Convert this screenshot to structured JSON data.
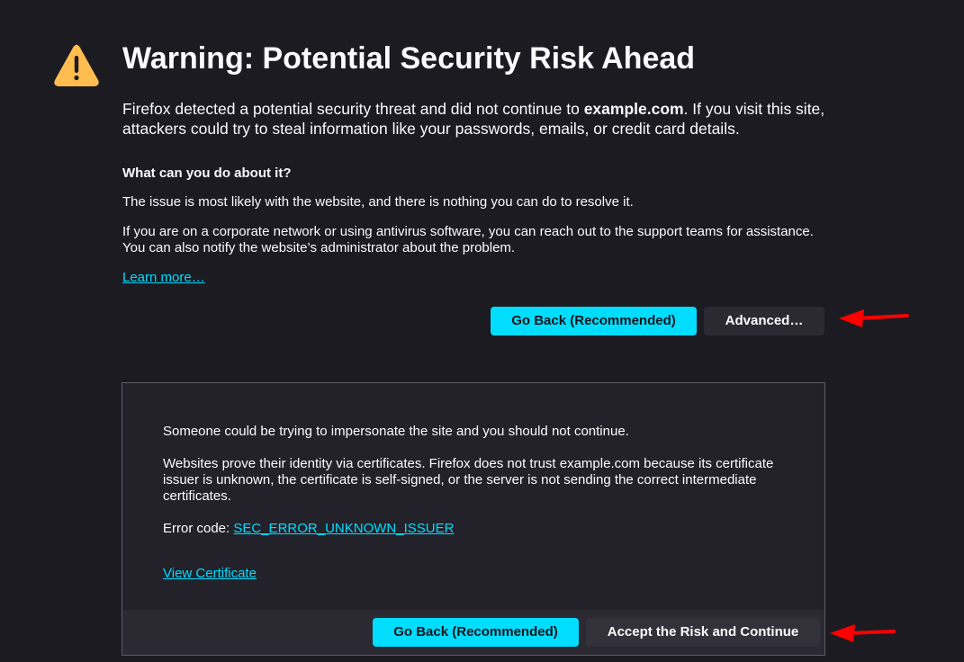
{
  "header": {
    "icon": "warning-icon",
    "title": "Warning: Potential Security Risk Ahead"
  },
  "intro": {
    "before": "Firefox detected a potential security threat and did not continue to ",
    "site": "example.com",
    "after": ". If you visit this site, attackers could try to steal information like your passwords, emails, or credit card details."
  },
  "help": {
    "heading": "What can you do about it?",
    "p1": "The issue is most likely with the website, and there is nothing you can do to resolve it.",
    "p2": "If you are on a corporate network or using antivirus software, you can reach out to the support teams for assistance. You can also notify the website’s administrator about the problem.",
    "learn_more": "Learn more…"
  },
  "buttons": {
    "go_back": "Go Back (Recommended)",
    "advanced": "Advanced…"
  },
  "advanced_panel": {
    "p1": "Someone could be trying to impersonate the site and you should not continue.",
    "p2": "Websites prove their identity via certificates. Firefox does not trust example.com because its certificate issuer is unknown, the certificate is self-signed, or the server is not sending the correct intermediate certificates.",
    "error_label": "Error code: ",
    "error_code": "SEC_ERROR_UNKNOWN_ISSUER",
    "view_certificate": "View Certificate",
    "go_back": "Go Back (Recommended)",
    "accept": "Accept the Risk and Continue"
  },
  "colors": {
    "background": "#1c1b22",
    "accent": "#00ddff",
    "warning": "#ffbd4f",
    "annotation_arrow": "#ff0000"
  }
}
